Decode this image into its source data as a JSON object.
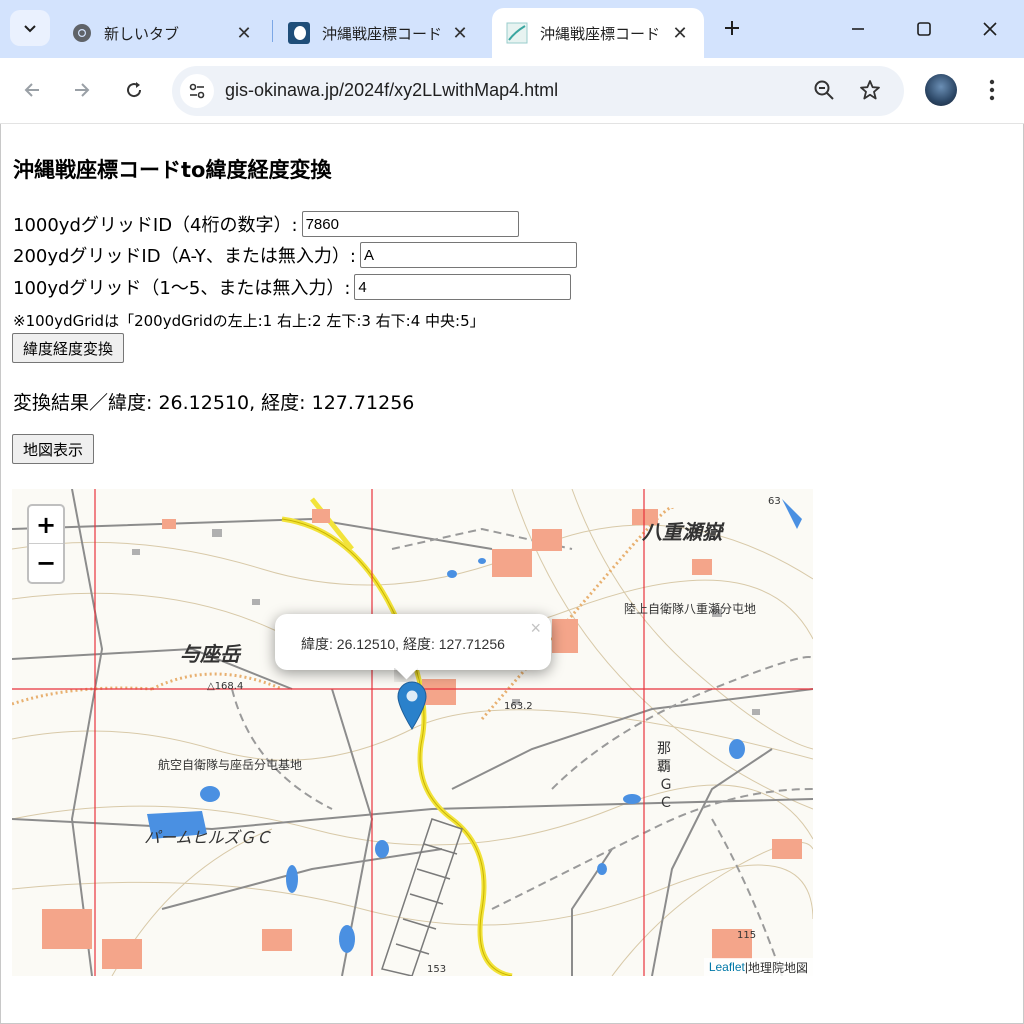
{
  "browser": {
    "tabs": [
      {
        "title": "新しいタブ",
        "icon": "chrome-icon",
        "active": false
      },
      {
        "title": "沖縄戦座標コード",
        "icon": "site-favicon",
        "active": false
      },
      {
        "title": "沖縄戦座標コード",
        "icon": "map-favicon",
        "active": true
      }
    ],
    "url": "gis-okinawa.jp/2024f/xy2LLwithMap4.html"
  },
  "page": {
    "title": "沖縄戦座標コードto緯度経度変換",
    "field1": {
      "label": "1000ydグリッドID（4桁の数字）:",
      "value": "7860"
    },
    "field2": {
      "label": "200ydグリッドID（A-Y、または無入力）:",
      "value": "A"
    },
    "field3": {
      "label": "100ydグリッド（1〜5、または無入力）:",
      "value": "4"
    },
    "note": "※100ydGridは「200ydGridの左上:1 右上:2 左下:3 右下:4 中央:5」",
    "convert_button": "緯度経度変換",
    "result": "変換結果／緯度: 26.12510, 経度: 127.71256",
    "map_button": "地図表示"
  },
  "map": {
    "zoom_in": "+",
    "zoom_out": "−",
    "popup_text": "緯度: 26.12510, 経度: 127.71256",
    "popup_close": "×",
    "attribution_link": "Leaflet",
    "attribution_sep": " | ",
    "attribution_text": "地理院地図",
    "labels": {
      "yaesedake": "八重瀬嶽",
      "yozadake": "与座岳",
      "jgsdf": "陸上自衛隊八重瀬分屯地",
      "jasdf": "航空自衛隊与座岳分屯基地",
      "palm": "パームヒルズＧＣ",
      "naha_gc": [
        "那",
        "覇",
        "Ｇ",
        "Ｃ"
      ],
      "elev168": "△168.4",
      "elev163": "163.2",
      "elev115": "115",
      "elev153": "153",
      "elev63": "63"
    },
    "colors": {
      "grid": "#e8323c",
      "road": "#f2e33a",
      "water": "#4a90e2",
      "building": "#f4a58a"
    }
  }
}
